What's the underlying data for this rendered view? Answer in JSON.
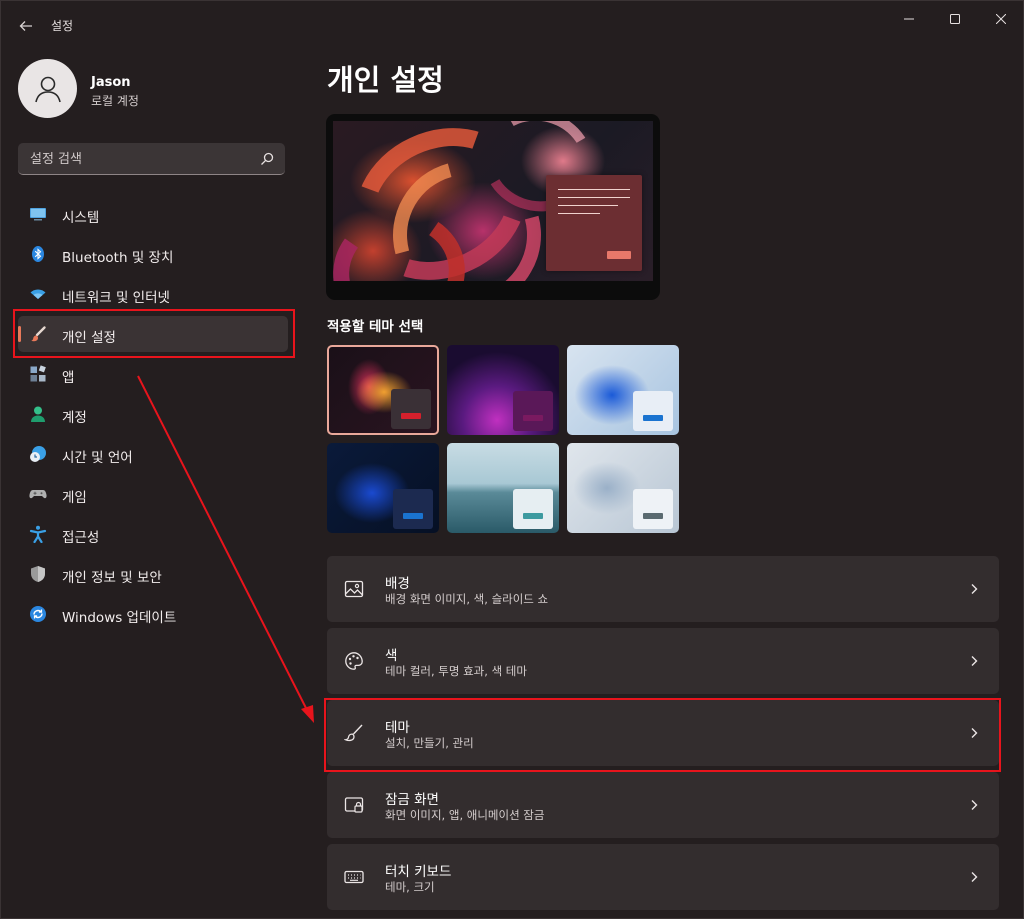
{
  "window": {
    "title": "설정",
    "back_icon": "back-arrow-icon",
    "controls": [
      "minimize-icon",
      "maximize-icon",
      "close-icon"
    ]
  },
  "profile": {
    "name": "Jason",
    "account_type": "로컬 계정",
    "avatar_icon": "person-icon"
  },
  "search": {
    "placeholder": "설정 검색",
    "icon": "search-icon"
  },
  "sidebar": {
    "items": [
      {
        "label": "시스템",
        "icon": "monitor-icon",
        "color": "#4fa3e0"
      },
      {
        "label": "Bluetooth 및 장치",
        "icon": "bluetooth-icon",
        "color": "#2b87e0"
      },
      {
        "label": "네트워크 및 인터넷",
        "icon": "wifi-icon",
        "color": "#3aa0e6"
      },
      {
        "label": "개인 설정",
        "icon": "paintbrush-icon",
        "color": "#e9795a",
        "selected": true
      },
      {
        "label": "앱",
        "icon": "apps-icon",
        "color": "#8aa8c8"
      },
      {
        "label": "계정",
        "icon": "account-icon",
        "color": "#34c08a"
      },
      {
        "label": "시간 및 언어",
        "icon": "clock-globe-icon",
        "color": "#3aa0e6"
      },
      {
        "label": "게임",
        "icon": "gamepad-icon",
        "color": "#a8a8a8"
      },
      {
        "label": "접근성",
        "icon": "accessibility-icon",
        "color": "#3aa0e6"
      },
      {
        "label": "개인 정보 및 보안",
        "icon": "shield-icon",
        "color": "#9a9a9a"
      },
      {
        "label": "Windows 업데이트",
        "icon": "update-icon",
        "color": "#2b87e0"
      }
    ]
  },
  "main": {
    "title": "개인 설정",
    "theme_section_label": "적용할 테마 선택",
    "themes": [
      {
        "name": "theme-glow-red",
        "accent": "#d4202c",
        "selected": true
      },
      {
        "name": "theme-purple-flow",
        "accent": "#7a1a60",
        "selected": false
      },
      {
        "name": "theme-windows-light",
        "accent": "#1a73d0",
        "selected": false
      },
      {
        "name": "theme-windows-dark",
        "accent": "#1a73d0",
        "selected": false
      },
      {
        "name": "theme-captured-motion",
        "accent": "#3d9aa0",
        "selected": false
      },
      {
        "name": "theme-sunrise",
        "accent": "#5a6a70",
        "selected": false
      }
    ],
    "cards": [
      {
        "title": "배경",
        "desc": "배경 화면 이미지, 색, 슬라이드 쇼",
        "icon": "image-icon"
      },
      {
        "title": "색",
        "desc": "테마 컬러, 투명 효과, 색 테마",
        "icon": "palette-icon"
      },
      {
        "title": "테마",
        "desc": "설치, 만들기, 관리",
        "icon": "paintbrush-icon"
      },
      {
        "title": "잠금 화면",
        "desc": "화면 이미지, 앱, 애니메이션 잠금",
        "icon": "lock-screen-icon"
      },
      {
        "title": "터치 키보드",
        "desc": "테마, 크기",
        "icon": "keyboard-icon"
      }
    ]
  },
  "annotation": {
    "highlight_color": "#e8141c"
  }
}
